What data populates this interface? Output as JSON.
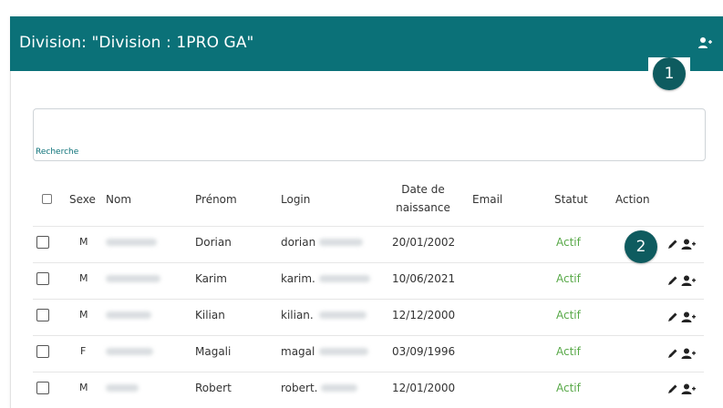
{
  "header": {
    "title": "Division: \"Division : 1PRO GA\"",
    "icon": "user-plus-icon",
    "color": "#0b7178"
  },
  "badges": {
    "one": "1",
    "two": "2"
  },
  "search": {
    "label": "Recherche",
    "value": ""
  },
  "table": {
    "columns": {
      "sexe": "Sexe",
      "nom": "Nom",
      "prenom": "Prénom",
      "login": "Login",
      "date_line1": "Date de",
      "date_line2": "naissance",
      "email": "Email",
      "statut": "Statut",
      "action": "Action"
    },
    "rows": [
      {
        "sexe": "M",
        "prenom": "Dorian",
        "login": "dorian",
        "date": "20/01/2002",
        "email": "",
        "statut": "Actif"
      },
      {
        "sexe": "M",
        "prenom": "Karim",
        "login": "karim.",
        "date": "10/06/2021",
        "email": "",
        "statut": "Actif"
      },
      {
        "sexe": "M",
        "prenom": "Kilian",
        "login": "kilian.",
        "date": "12/12/2000",
        "email": "",
        "statut": "Actif"
      },
      {
        "sexe": "F",
        "prenom": "Magali",
        "login": "magal",
        "date": "03/09/1996",
        "email": "",
        "statut": "Actif"
      },
      {
        "sexe": "M",
        "prenom": "Robert",
        "login": "robert.",
        "date": "12/01/2000",
        "email": "",
        "statut": "Actif"
      }
    ],
    "status_color": "#58a948"
  }
}
